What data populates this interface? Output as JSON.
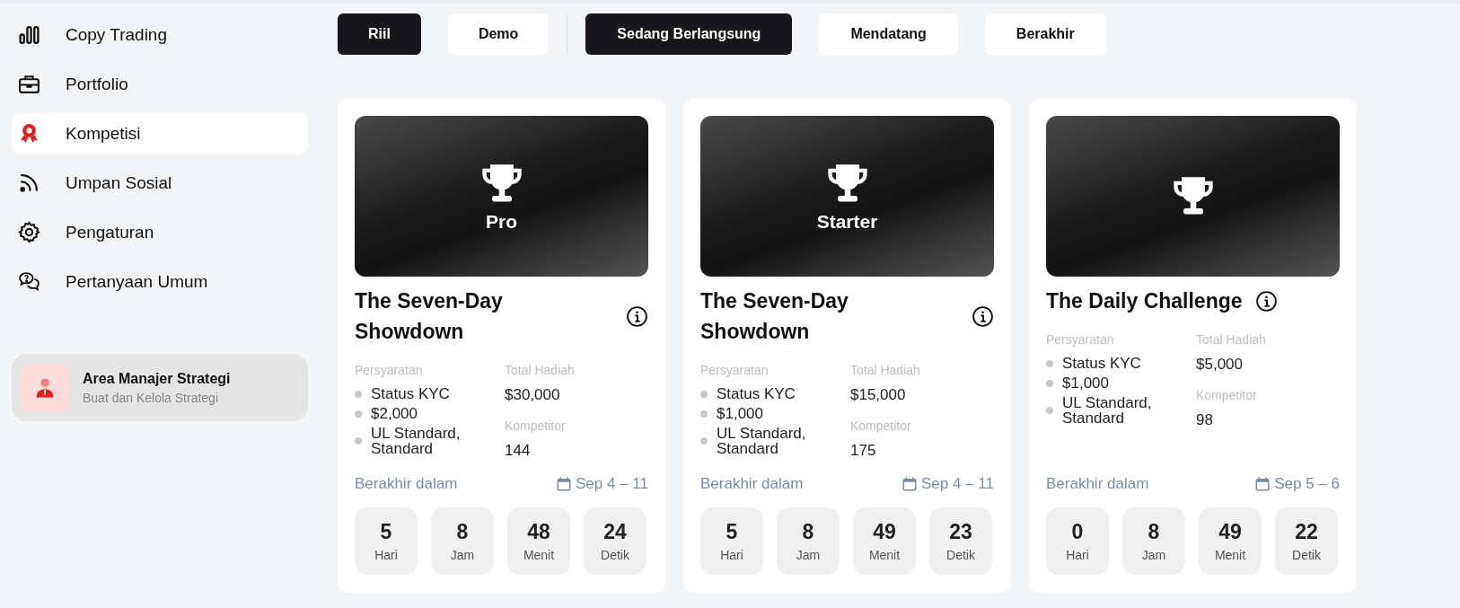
{
  "sidebar": {
    "items": [
      {
        "label": "Copy Trading",
        "selected": false
      },
      {
        "label": "Portfolio",
        "selected": false
      },
      {
        "label": "Kompetisi",
        "selected": true
      },
      {
        "label": "Umpan Sosial",
        "selected": false
      },
      {
        "label": "Pengaturan",
        "selected": false
      },
      {
        "label": "Pertanyaan Umum",
        "selected": false
      }
    ],
    "manager_card": {
      "title": "Area Manajer Strategi",
      "subtitle": "Buat dan Kelola Strategi"
    }
  },
  "filters": {
    "account": [
      {
        "label": "Riil",
        "selected": true
      },
      {
        "label": "Demo",
        "selected": false
      }
    ],
    "status": [
      {
        "label": "Sedang Berlangsung",
        "selected": true
      },
      {
        "label": "Mendatang",
        "selected": false
      },
      {
        "label": "Berakhir",
        "selected": false
      }
    ]
  },
  "competitions": [
    {
      "badge": "Pro",
      "title": "The Seven-Day Showdown",
      "requirements_label": "Persyaratan",
      "requirements": [
        "Status KYC",
        "$2,000",
        "UL Standard, Standard"
      ],
      "prize_label": "Total Hadiah",
      "prize": "$30,000",
      "competitors_label": "Kompetitor",
      "competitors": "144",
      "ends_label": "Berakhir dalam",
      "dates": "Sep 4 – 11",
      "countdown": [
        {
          "value": "5",
          "unit": "Hari"
        },
        {
          "value": "8",
          "unit": "Jam"
        },
        {
          "value": "48",
          "unit": "Menit"
        },
        {
          "value": "24",
          "unit": "Detik"
        }
      ]
    },
    {
      "badge": "Starter",
      "title": "The Seven-Day Showdown",
      "requirements_label": "Persyaratan",
      "requirements": [
        "Status KYC",
        "$1,000",
        "UL Standard, Standard"
      ],
      "prize_label": "Total Hadiah",
      "prize": "$15,000",
      "competitors_label": "Kompetitor",
      "competitors": "175",
      "ends_label": "Berakhir dalam",
      "dates": "Sep 4 – 11",
      "countdown": [
        {
          "value": "5",
          "unit": "Hari"
        },
        {
          "value": "8",
          "unit": "Jam"
        },
        {
          "value": "49",
          "unit": "Menit"
        },
        {
          "value": "23",
          "unit": "Detik"
        }
      ]
    },
    {
      "title": "The Daily Challenge",
      "requirements_label": "Persyaratan",
      "requirements": [
        "Status KYC",
        "$1,000",
        "UL Standard, Standard"
      ],
      "prize_label": "Total Hadiah",
      "prize": "$5,000",
      "competitors_label": "Kompetitor",
      "competitors": "98",
      "ends_label": "Berakhir dalam",
      "dates": "Sep 5 – 6",
      "countdown": [
        {
          "value": "0",
          "unit": "Hari"
        },
        {
          "value": "8",
          "unit": "Jam"
        },
        {
          "value": "49",
          "unit": "Menit"
        },
        {
          "value": "22",
          "unit": "Detik"
        }
      ]
    }
  ]
}
